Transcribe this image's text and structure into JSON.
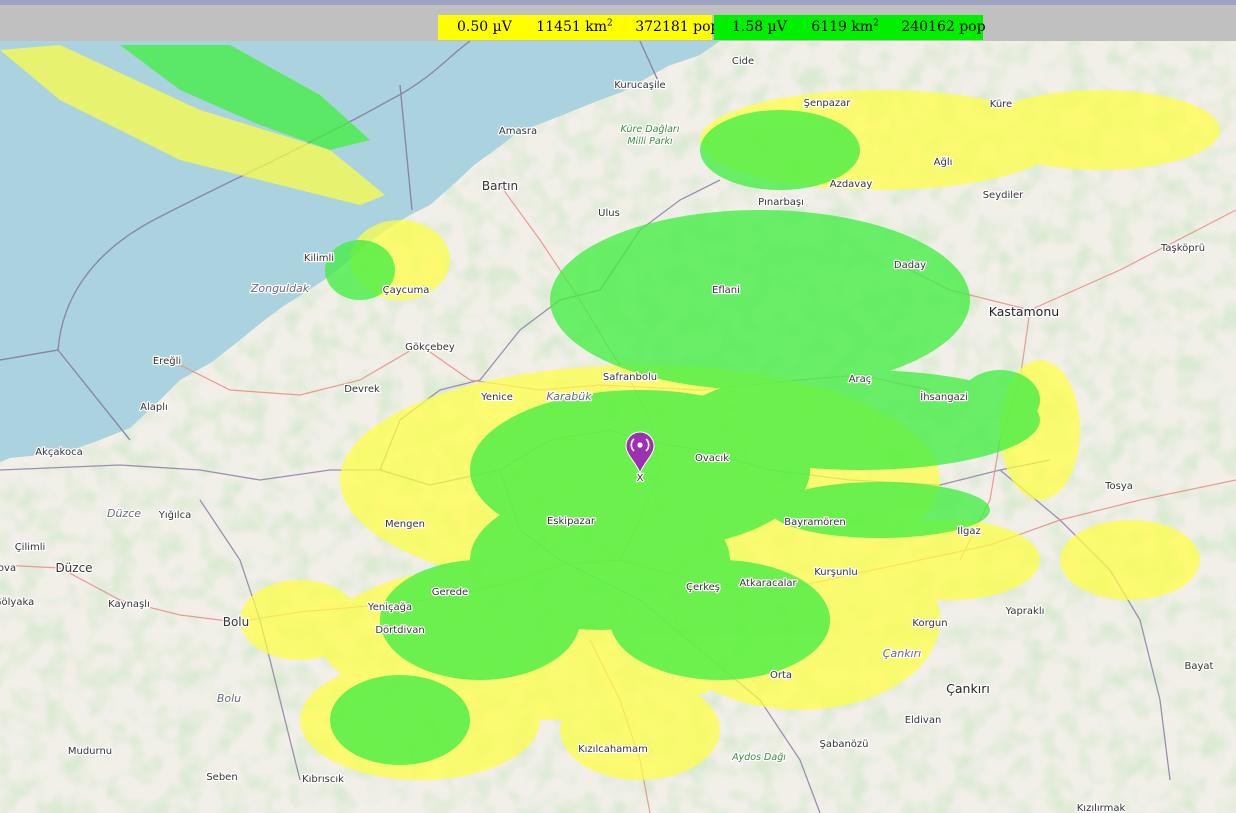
{
  "legend": {
    "yellow": {
      "level": "0.50 µV",
      "area": "11451 km",
      "pop": "372181 pop",
      "color": "#ffff00"
    },
    "green": {
      "level": "1.58 µV",
      "area": "6119 km",
      "pop": "240162 pop",
      "color": "#00f000"
    },
    "area_exponent": "2"
  },
  "transmitter": {
    "label": "X",
    "icon": "radio-tower-marker-icon",
    "color": "#9b30b0"
  },
  "map": {
    "colors": {
      "sea": "#aad3df",
      "land": "#f2efe9",
      "forest": "#add19e",
      "coverage_yellow": "#ffff44",
      "coverage_green": "#44ee44"
    },
    "places": [
      "Cide",
      "Kurucaşile",
      "Şenpazar",
      "Küre",
      "Amasra",
      "Küre Dağları",
      "Milli Parkı",
      "Bartın",
      "Ağlı",
      "Azdavay",
      "Pınarbaşı",
      "Seydiler",
      "Ulus",
      "Taşköprü",
      "Kilimli",
      "Daday",
      "Zonguldak",
      "Çaycuma",
      "Eflani",
      "Kastamonu",
      "Gökçebey",
      "Ereğli",
      "Safranbolu",
      "Araç",
      "Devrek",
      "Yenice",
      "Karabük",
      "İhsangazi",
      "Alaplı",
      "Ovacık",
      "Akçakoca",
      "Tosya",
      "Düzce",
      "Yığılca",
      "Mengen",
      "Eskipazar",
      "Bayramören",
      "Ilgaz",
      "Çilimli",
      "Düzce",
      "ova",
      "Kurşunlu",
      "Atkaracalar",
      "Çerkeş",
      "Gerede",
      "Yeniçağa",
      "Kaynaşlı",
      "Gölyaka",
      "Bolu",
      "Yapraklı",
      "Dörtdivan",
      "Korgun",
      "Çankırı",
      "Bayat",
      "Orta",
      "Çankırı",
      "Bolu",
      "Eldivan",
      "Mudurnu",
      "Şabanözü",
      "Kızılcahamam",
      "Aydos Dağı",
      "Seben",
      "Kıbrıscık",
      "Kızılırmak"
    ]
  }
}
